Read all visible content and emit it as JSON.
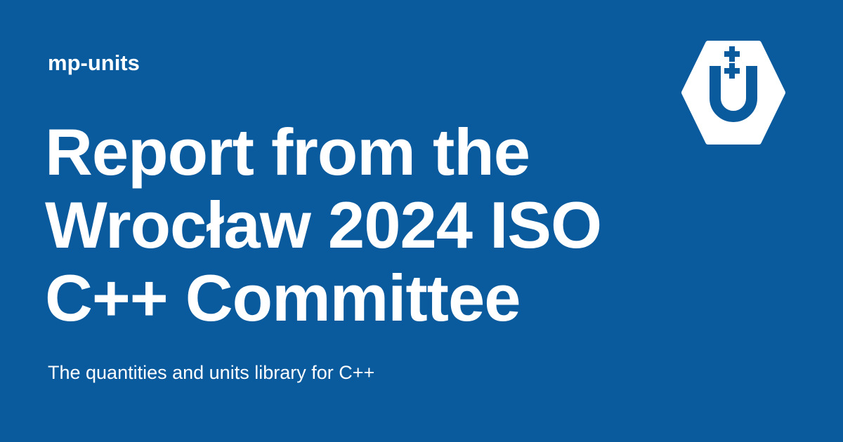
{
  "site": {
    "name": "mp-units"
  },
  "title": {
    "lines": [
      "Report from the",
      "Wrocław 2024 ISO",
      "C++ Committee"
    ]
  },
  "subtitle": "The quantities and units library for C++",
  "logo": {
    "icon": "mp-units-logo-icon"
  },
  "colors": {
    "background": "#0a5a9e",
    "text": "#ffffff"
  }
}
